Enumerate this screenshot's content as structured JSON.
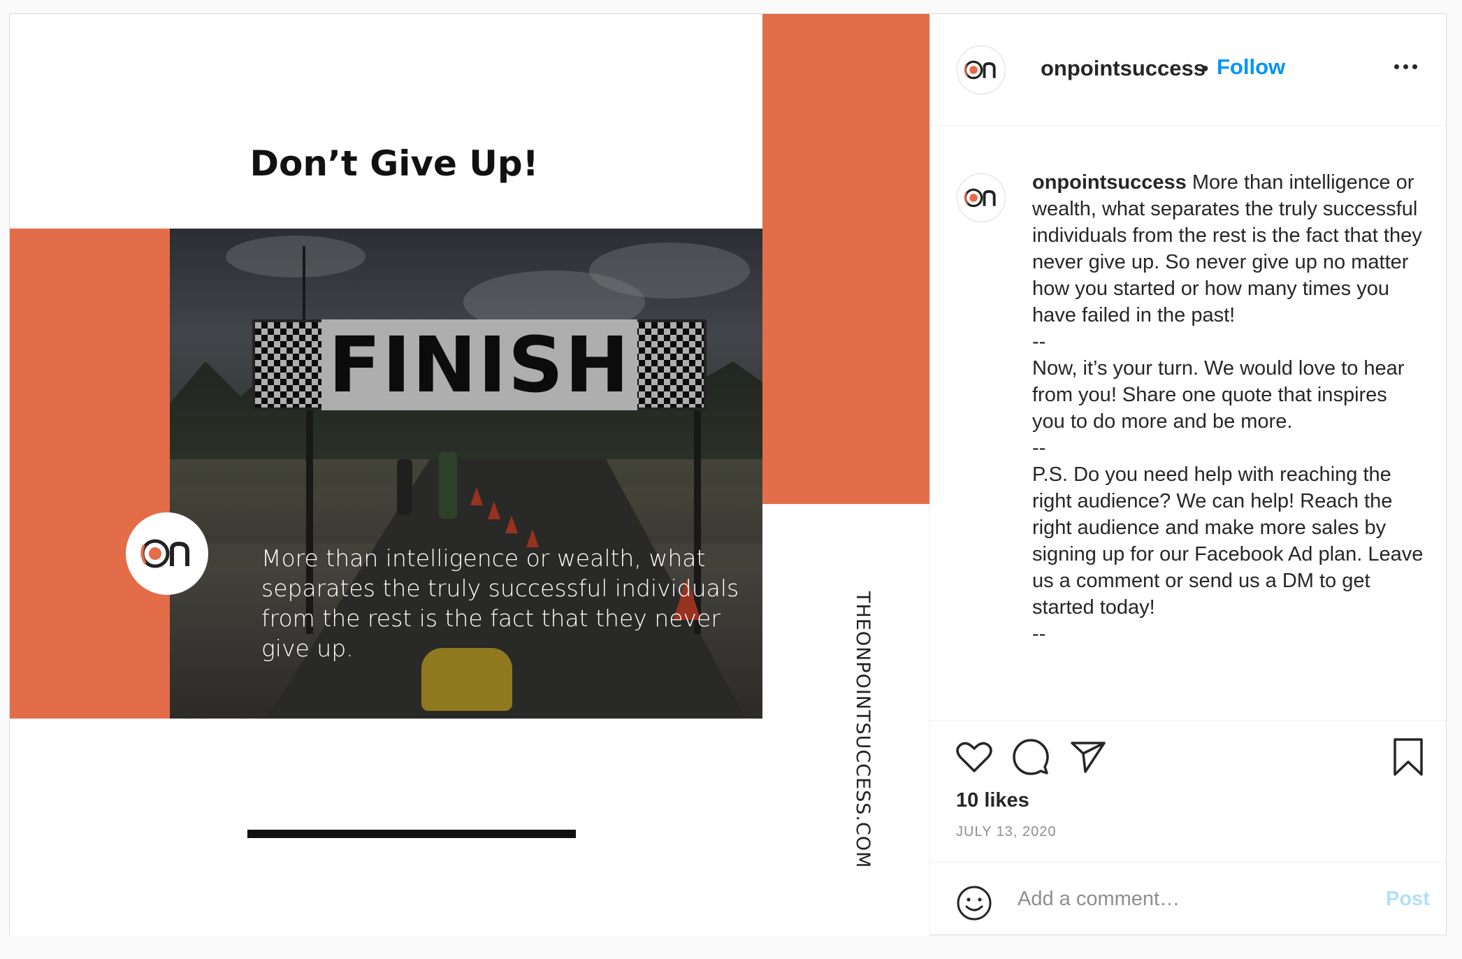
{
  "post_image": {
    "headline": "Don’t Give Up!",
    "banner_text": "FINISH",
    "quote": "More than intelligence or wealth, what separates the truly successful individuals from the rest is the fact that they never give up.",
    "vertical_url": "THEONPOINTSUCCESS.COM",
    "logo_text": "On"
  },
  "header": {
    "username": "onpointsuccess",
    "separator": "•",
    "follow_label": "Follow",
    "more_icon": "more-options-icon"
  },
  "caption": {
    "username": "onpointsuccess",
    "text": " More than intelligence or wealth, what separates the truly successful individuals from the rest is the fact that they never give up. So never give up no matter how you started or how many times you have failed in the past!\n--\nNow, it’s your turn. We would love to hear from you! Share one quote that inspires you to do more and be more.\n--\nP.S. Do you need help with reaching the right audience? We can help! Reach the right audience and make more sales by signing up for our Facebook Ad plan. Leave us a comment or send us a DM to get started today!\n--"
  },
  "actions": {
    "likes": "10 likes",
    "date": "JULY 13, 2020",
    "icons": [
      "heart-icon",
      "comment-icon",
      "share-icon",
      "bookmark-icon"
    ]
  },
  "comment": {
    "placeholder": "Add a comment…",
    "post_label": "Post",
    "emoji_icon": "emoji-icon"
  },
  "colors": {
    "brand_orange": "#e36d48",
    "follow_blue": "#0095f6",
    "post_disabled": "#b2dffc"
  }
}
